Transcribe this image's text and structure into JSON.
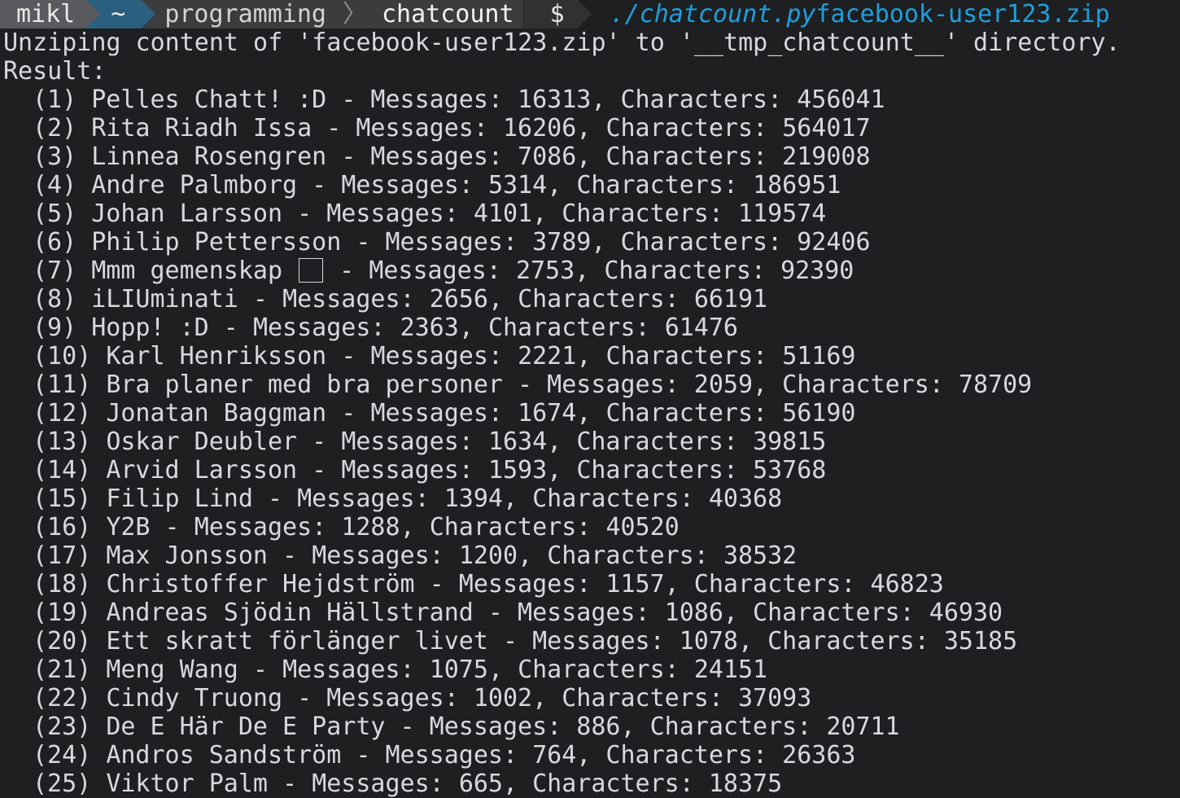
{
  "prompt": {
    "user": "mikl",
    "home": "~",
    "dir1": "programming",
    "separator": "〉",
    "dir2": "chatcount",
    "symbol": "$",
    "command_exec": "./chatcount.py",
    "command_arg": "facebook-user123.zip"
  },
  "output": {
    "unzip_line": "Unziping content of 'facebook-user123.zip' to '__tmp_chatcount__' directory.",
    "result_label": "Result:"
  },
  "results": [
    {
      "index": "(1)",
      "name": "Pelles Chatt! :D",
      "messages": "16313",
      "characters": "456041"
    },
    {
      "index": "(2)",
      "name": "Rita Riadh Issa",
      "messages": "16206",
      "characters": "564017"
    },
    {
      "index": "(3)",
      "name": "Linnea Rosengren",
      "messages": "7086",
      "characters": "219008"
    },
    {
      "index": "(4)",
      "name": "Andre Palmborg",
      "messages": "5314",
      "characters": "186951"
    },
    {
      "index": "(5)",
      "name": "Johan Larsson",
      "messages": "4101",
      "characters": "119574"
    },
    {
      "index": "(6)",
      "name": "Philip Pettersson",
      "messages": "3789",
      "characters": "92406"
    },
    {
      "index": "(7)",
      "name": "Mmm gemenskap",
      "has_box_glyph": true,
      "messages": "2753",
      "characters": "92390"
    },
    {
      "index": "(8)",
      "name": "iLIUminati",
      "messages": "2656",
      "characters": "66191"
    },
    {
      "index": "(9)",
      "name": "Hopp! :D",
      "messages": "2363",
      "characters": "61476"
    },
    {
      "index": "(10)",
      "name": "Karl Henriksson",
      "messages": "2221",
      "characters": "51169"
    },
    {
      "index": "(11)",
      "name": "Bra planer med bra personer",
      "messages": "2059",
      "characters": "78709"
    },
    {
      "index": "(12)",
      "name": "Jonatan Baggman",
      "messages": "1674",
      "characters": "56190"
    },
    {
      "index": "(13)",
      "name": "Oskar Deubler",
      "messages": "1634",
      "characters": "39815"
    },
    {
      "index": "(14)",
      "name": "Arvid Larsson",
      "messages": "1593",
      "characters": "53768"
    },
    {
      "index": "(15)",
      "name": "Filip Lind",
      "messages": "1394",
      "characters": "40368"
    },
    {
      "index": "(16)",
      "name": "Y2B",
      "messages": "1288",
      "characters": "40520"
    },
    {
      "index": "(17)",
      "name": "Max Jonsson",
      "messages": "1200",
      "characters": "38532"
    },
    {
      "index": "(18)",
      "name": "Christoffer Hejdström",
      "messages": "1157",
      "characters": "46823"
    },
    {
      "index": "(19)",
      "name": "Andreas Sjödin Hällstrand",
      "messages": "1086",
      "characters": "46930"
    },
    {
      "index": "(20)",
      "name": "Ett skratt förlänger livet",
      "messages": "1078",
      "characters": "35185"
    },
    {
      "index": "(21)",
      "name": "Meng Wang",
      "messages": "1075",
      "characters": "24151"
    },
    {
      "index": "(22)",
      "name": "Cindy Truong",
      "messages": "1002",
      "characters": "37093"
    },
    {
      "index": "(23)",
      "name": "De E Här De E Party",
      "messages": "886",
      "characters": "20711"
    },
    {
      "index": "(24)",
      "name": "Andros Sandström",
      "messages": "764",
      "characters": "26363"
    },
    {
      "index": "(25)",
      "name": "Viktor Palm",
      "messages": "665",
      "characters": "18375"
    }
  ],
  "labels": {
    "dash": " - ",
    "messages": "Messages: ",
    "comma": ", ",
    "characters": "Characters: "
  },
  "colors": {
    "background": "#1d1f21",
    "foreground": "#d7dadd",
    "command": "#1e9fdd",
    "user_segment": "#585a5d",
    "home_segment": "#2b5f7f",
    "dir_segment": "#3a3c3e"
  }
}
